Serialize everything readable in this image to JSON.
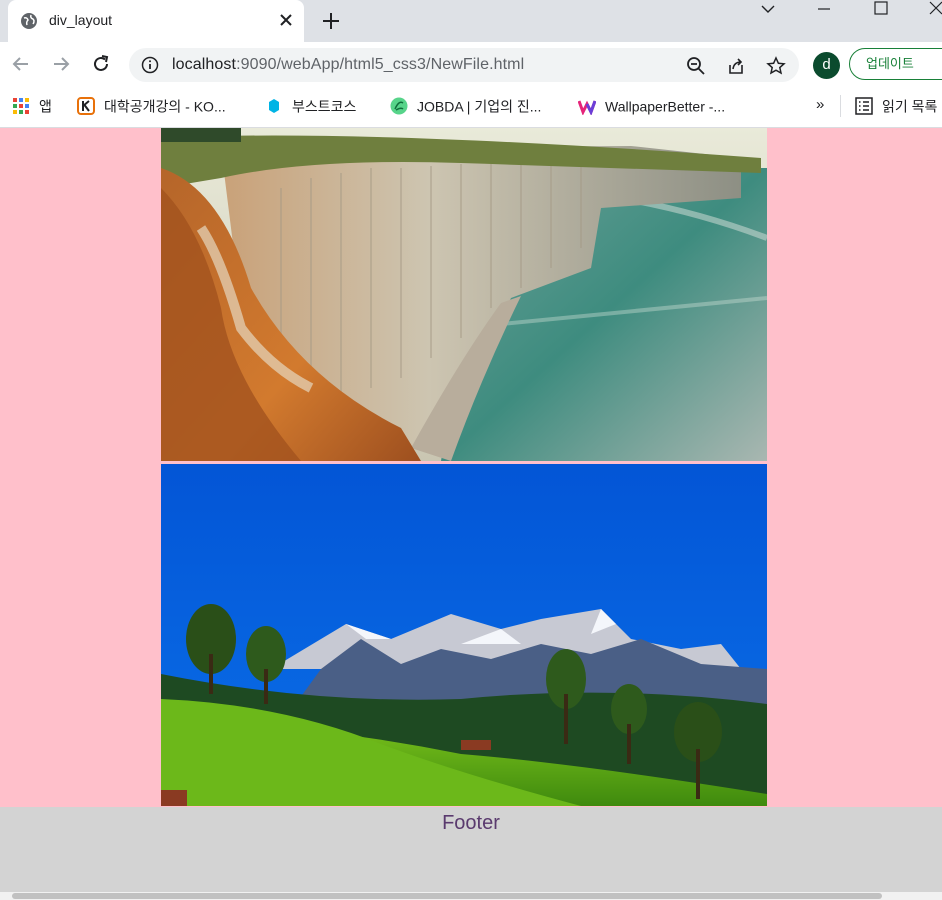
{
  "tab": {
    "title": "div_layout",
    "favicon": "globe-icon"
  },
  "toolbar": {
    "url_host": "localhost",
    "url_path": ":9090/webApp/html5_css3/NewFile.html",
    "avatar_letter": "d",
    "update_label": "업데이트"
  },
  "bookmarks": [
    {
      "label": "앱",
      "icon": "apps-grid-icon"
    },
    {
      "label": "대학공개강의 - KO...",
      "icon": "kocw-icon"
    },
    {
      "label": "부스트코스",
      "icon": "boostcourse-icon"
    },
    {
      "label": "JOBDA | 기업의 진...",
      "icon": "jobda-icon"
    },
    {
      "label": "WallpaperBetter -...",
      "icon": "wallpaperbetter-icon"
    }
  ],
  "bookmarks_more": "»",
  "reading_list": {
    "label": "읽기 목록",
    "icon": "reading-list-icon"
  },
  "page": {
    "images": [
      {
        "subject": "coastal cliffs by the sea"
      },
      {
        "subject": "alpine mountains and green meadow"
      }
    ],
    "footer_text": "Footer"
  },
  "colors": {
    "page_background": "#ffc0cb",
    "footer_background": "#d3d3d3",
    "tabstrip": "#dee1e6",
    "accent_green": "#188038"
  }
}
